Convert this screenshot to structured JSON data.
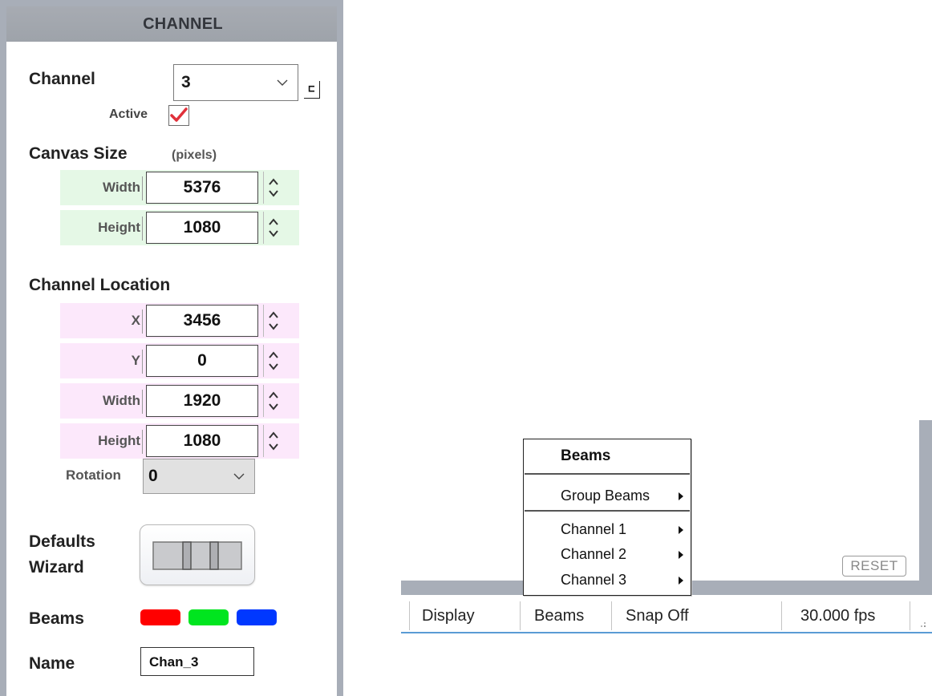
{
  "panel": {
    "header": "CHANNEL",
    "channel": {
      "label": "Channel",
      "selected": "3",
      "corner_button": "⊏",
      "active_label": "Active",
      "active_checked": true
    },
    "canvas_size": {
      "label": "Canvas Size",
      "unit": "(pixels)",
      "width_label": "Width",
      "width_value": "5376",
      "height_label": "Height",
      "height_value": "1080"
    },
    "channel_location": {
      "label": "Channel Location",
      "x_label": "X",
      "x_value": "3456",
      "y_label": "Y",
      "y_value": "0",
      "width_label": "Width",
      "width_value": "1920",
      "height_label": "Height",
      "height_value": "1080"
    },
    "rotation": {
      "label": "Rotation",
      "value": "0"
    },
    "defaults_wizard": {
      "label_line1": "Defaults",
      "label_line2": "Wizard"
    },
    "beams": {
      "label": "Beams",
      "colors": [
        "#ff0000",
        "#00e51f",
        "#0038ff"
      ]
    },
    "name": {
      "label": "Name",
      "value": "Chan_3"
    }
  },
  "reset_button": "RESET",
  "context_menu": {
    "title": "Beams",
    "items": [
      {
        "label": "Group Beams",
        "submenu": true
      },
      {
        "label": "Channel 1",
        "submenu": true
      },
      {
        "label": "Channel 2",
        "submenu": true
      },
      {
        "label": "Channel 3",
        "submenu": true
      }
    ]
  },
  "status_bar": {
    "display": "Display",
    "beams": "Beams",
    "snap": "Snap Off",
    "fps": "30.000 fps"
  },
  "colors": {
    "panel_frame": "#a8aeb8",
    "canvas_row_bg": "#e5f8e6",
    "location_row_bg": "#fce8fb",
    "check_mark": "#e0303a",
    "status_border": "#5a9bd5"
  }
}
